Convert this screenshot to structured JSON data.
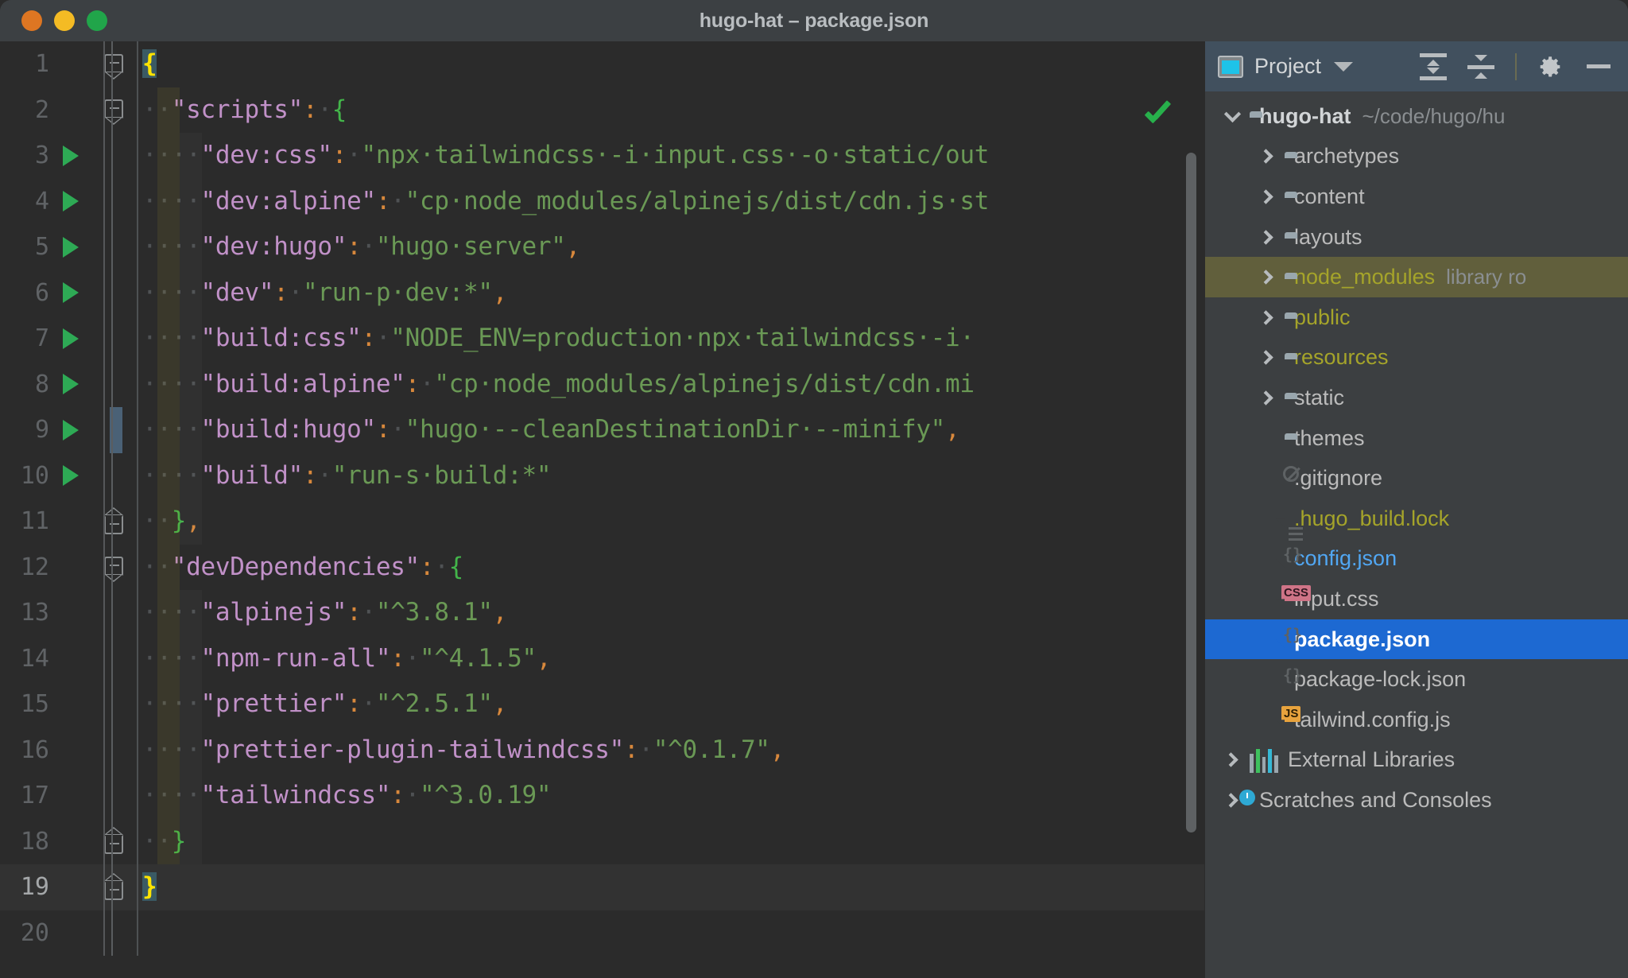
{
  "window": {
    "title": "hugo-hat – package.json",
    "traffic_lights": [
      "close-red",
      "minimize-yellow",
      "zoom-green"
    ]
  },
  "editor": {
    "file": "package.json",
    "inspection_status": "ok",
    "current_line": 19,
    "lines": [
      {
        "n": 1,
        "run": false,
        "fold": "top",
        "tokens": [
          {
            "t": "brace-hl",
            "v": "{"
          }
        ]
      },
      {
        "n": 2,
        "run": false,
        "fold": "top",
        "tokens": [
          {
            "t": "dot",
            "v": "··"
          },
          {
            "t": "key",
            "v": "\"scripts\""
          },
          {
            "t": "punct",
            "v": ":"
          },
          {
            "t": "dot",
            "v": "·"
          },
          {
            "t": "brace",
            "v": "{"
          }
        ]
      },
      {
        "n": 3,
        "run": true,
        "fold": "",
        "tokens": [
          {
            "t": "dot",
            "v": "····"
          },
          {
            "t": "key",
            "v": "\"dev:css\""
          },
          {
            "t": "punct",
            "v": ":"
          },
          {
            "t": "dot",
            "v": "·"
          },
          {
            "t": "str",
            "v": "\"npx·tailwindcss·-i·input.css·-o·static/out"
          }
        ]
      },
      {
        "n": 4,
        "run": true,
        "fold": "",
        "tokens": [
          {
            "t": "dot",
            "v": "····"
          },
          {
            "t": "key",
            "v": "\"dev:alpine\""
          },
          {
            "t": "punct",
            "v": ":"
          },
          {
            "t": "dot",
            "v": "·"
          },
          {
            "t": "str",
            "v": "\"cp·node_modules/alpinejs/dist/cdn.js·st"
          }
        ]
      },
      {
        "n": 5,
        "run": true,
        "fold": "",
        "tokens": [
          {
            "t": "dot",
            "v": "····"
          },
          {
            "t": "key",
            "v": "\"dev:hugo\""
          },
          {
            "t": "punct",
            "v": ":"
          },
          {
            "t": "dot",
            "v": "·"
          },
          {
            "t": "str",
            "v": "\"hugo·server\""
          },
          {
            "t": "punct",
            "v": ","
          }
        ]
      },
      {
        "n": 6,
        "run": true,
        "fold": "",
        "tokens": [
          {
            "t": "dot",
            "v": "····"
          },
          {
            "t": "key",
            "v": "\"dev\""
          },
          {
            "t": "punct",
            "v": ":"
          },
          {
            "t": "dot",
            "v": "·"
          },
          {
            "t": "str",
            "v": "\"run-p·dev:*\""
          },
          {
            "t": "punct",
            "v": ","
          }
        ]
      },
      {
        "n": 7,
        "run": true,
        "fold": "",
        "tokens": [
          {
            "t": "dot",
            "v": "····"
          },
          {
            "t": "key",
            "v": "\"build:css\""
          },
          {
            "t": "punct",
            "v": ":"
          },
          {
            "t": "dot",
            "v": "·"
          },
          {
            "t": "str",
            "v": "\"NODE_ENV=production·npx·tailwindcss·-i·"
          }
        ]
      },
      {
        "n": 8,
        "run": true,
        "fold": "",
        "tokens": [
          {
            "t": "dot",
            "v": "····"
          },
          {
            "t": "key",
            "v": "\"build:alpine\""
          },
          {
            "t": "punct",
            "v": ":"
          },
          {
            "t": "dot",
            "v": "·"
          },
          {
            "t": "str",
            "v": "\"cp·node_modules/alpinejs/dist/cdn.mi"
          }
        ]
      },
      {
        "n": 9,
        "run": true,
        "fold": "",
        "changed": true,
        "tokens": [
          {
            "t": "dot",
            "v": "····"
          },
          {
            "t": "key",
            "v": "\"build:hugo\""
          },
          {
            "t": "punct",
            "v": ":"
          },
          {
            "t": "dot",
            "v": "·"
          },
          {
            "t": "str",
            "v": "\"hugo·--cleanDestinationDir·--minify\""
          },
          {
            "t": "punct",
            "v": ","
          }
        ]
      },
      {
        "n": 10,
        "run": true,
        "fold": "",
        "tokens": [
          {
            "t": "dot",
            "v": "····"
          },
          {
            "t": "key",
            "v": "\"build\""
          },
          {
            "t": "punct",
            "v": ":"
          },
          {
            "t": "dot",
            "v": "·"
          },
          {
            "t": "str",
            "v": "\"run-s·build:*\""
          }
        ]
      },
      {
        "n": 11,
        "run": false,
        "fold": "bot",
        "tokens": [
          {
            "t": "dot",
            "v": "··"
          },
          {
            "t": "brace",
            "v": "}"
          },
          {
            "t": "punct",
            "v": ","
          }
        ]
      },
      {
        "n": 12,
        "run": false,
        "fold": "top",
        "tokens": [
          {
            "t": "dot",
            "v": "··"
          },
          {
            "t": "key",
            "v": "\"devDependencies\""
          },
          {
            "t": "punct",
            "v": ":"
          },
          {
            "t": "dot",
            "v": "·"
          },
          {
            "t": "brace",
            "v": "{"
          }
        ]
      },
      {
        "n": 13,
        "run": false,
        "fold": "",
        "tokens": [
          {
            "t": "dot",
            "v": "····"
          },
          {
            "t": "key",
            "v": "\"alpinejs\""
          },
          {
            "t": "punct",
            "v": ":"
          },
          {
            "t": "dot",
            "v": "·"
          },
          {
            "t": "str",
            "v": "\"^3.8.1\""
          },
          {
            "t": "punct",
            "v": ","
          }
        ]
      },
      {
        "n": 14,
        "run": false,
        "fold": "",
        "tokens": [
          {
            "t": "dot",
            "v": "····"
          },
          {
            "t": "key",
            "v": "\"npm-run-all\""
          },
          {
            "t": "punct",
            "v": ":"
          },
          {
            "t": "dot",
            "v": "·"
          },
          {
            "t": "str",
            "v": "\"^4.1.5\""
          },
          {
            "t": "punct",
            "v": ","
          }
        ]
      },
      {
        "n": 15,
        "run": false,
        "fold": "",
        "tokens": [
          {
            "t": "dot",
            "v": "····"
          },
          {
            "t": "key",
            "v": "\"prettier\""
          },
          {
            "t": "punct",
            "v": ":"
          },
          {
            "t": "dot",
            "v": "·"
          },
          {
            "t": "str",
            "v": "\"^2.5.1\""
          },
          {
            "t": "punct",
            "v": ","
          }
        ]
      },
      {
        "n": 16,
        "run": false,
        "fold": "",
        "tokens": [
          {
            "t": "dot",
            "v": "····"
          },
          {
            "t": "key",
            "v": "\"prettier-plugin-tailwindcss\""
          },
          {
            "t": "punct",
            "v": ":"
          },
          {
            "t": "dot",
            "v": "·"
          },
          {
            "t": "str",
            "v": "\"^0.1.7\""
          },
          {
            "t": "punct",
            "v": ","
          }
        ]
      },
      {
        "n": 17,
        "run": false,
        "fold": "",
        "tokens": [
          {
            "t": "dot",
            "v": "····"
          },
          {
            "t": "key",
            "v": "\"tailwindcss\""
          },
          {
            "t": "punct",
            "v": ":"
          },
          {
            "t": "dot",
            "v": "·"
          },
          {
            "t": "str",
            "v": "\"^3.0.19\""
          }
        ]
      },
      {
        "n": 18,
        "run": false,
        "fold": "bot",
        "tokens": [
          {
            "t": "dot",
            "v": "··"
          },
          {
            "t": "brace",
            "v": "}"
          }
        ]
      },
      {
        "n": 19,
        "run": false,
        "fold": "bot",
        "current": true,
        "tokens": [
          {
            "t": "brace-hl",
            "v": "}"
          }
        ]
      },
      {
        "n": 20,
        "run": false,
        "fold": "",
        "tokens": []
      }
    ]
  },
  "project_panel": {
    "title": "Project",
    "toolbar": [
      "project-view-dropdown",
      "expand-all-icon",
      "collapse-all-icon",
      "settings-gear-icon",
      "minimize-icon"
    ],
    "tree": [
      {
        "label": "hugo-hat",
        "hint": "~/code/hugo/hu",
        "indent": 0,
        "arrow": "down",
        "icon": "folder",
        "style": "bold"
      },
      {
        "label": "archetypes",
        "hint": "",
        "indent": 1,
        "arrow": "right",
        "icon": "folder",
        "style": "normal"
      },
      {
        "label": "content",
        "hint": "",
        "indent": 1,
        "arrow": "right",
        "icon": "folder",
        "style": "normal"
      },
      {
        "label": "layouts",
        "hint": "",
        "indent": 1,
        "arrow": "right",
        "icon": "folder",
        "style": "normal"
      },
      {
        "label": "node_modules",
        "hint": "library ro",
        "indent": 1,
        "arrow": "right",
        "icon": "folder",
        "style": "olive",
        "row": "highlight"
      },
      {
        "label": "public",
        "hint": "",
        "indent": 1,
        "arrow": "right",
        "icon": "folder",
        "style": "olive"
      },
      {
        "label": "resources",
        "hint": "",
        "indent": 1,
        "arrow": "right",
        "icon": "folder",
        "style": "olive"
      },
      {
        "label": "static",
        "hint": "",
        "indent": 1,
        "arrow": "right",
        "icon": "folder",
        "style": "normal"
      },
      {
        "label": "themes",
        "hint": "",
        "indent": 1,
        "arrow": "none",
        "icon": "folder",
        "style": "normal"
      },
      {
        "label": ".gitignore",
        "hint": "",
        "indent": 1,
        "arrow": "none",
        "icon": "file-ignored",
        "style": "normal"
      },
      {
        "label": ".hugo_build.lock",
        "hint": "",
        "indent": 1,
        "arrow": "none",
        "icon": "file-text",
        "style": "olive"
      },
      {
        "label": "config.json",
        "hint": "",
        "indent": 1,
        "arrow": "none",
        "icon": "file-json",
        "style": "blue"
      },
      {
        "label": "input.css",
        "hint": "",
        "indent": 1,
        "arrow": "none",
        "icon": "file-css",
        "style": "normal"
      },
      {
        "label": "package.json",
        "hint": "",
        "indent": 1,
        "arrow": "none",
        "icon": "file-json",
        "style": "selected",
        "row": "selected"
      },
      {
        "label": "package-lock.json",
        "hint": "",
        "indent": 1,
        "arrow": "none",
        "icon": "file-json",
        "style": "normal"
      },
      {
        "label": "tailwind.config.js",
        "hint": "",
        "indent": 1,
        "arrow": "none",
        "icon": "file-js",
        "style": "normal"
      },
      {
        "label": "External Libraries",
        "hint": "",
        "indent": 0,
        "arrow": "right",
        "icon": "libraries",
        "style": "normal"
      },
      {
        "label": "Scratches and Consoles",
        "hint": "",
        "indent": 0,
        "arrow": "right",
        "icon": "scratches",
        "style": "normal"
      }
    ]
  },
  "colors": {
    "titlebar_bg": "#3c4043",
    "editor_bg": "#2b2b2b",
    "panel_bg": "#3c3f41",
    "selection_blue": "#1d69d2",
    "panel_header_blue": "#41505e",
    "string_green": "#6a9955",
    "key_purple": "#c191c8",
    "punct_orange": "#d8883c",
    "brace_green": "#43b54a",
    "run_arrow_green": "#2eaa55",
    "olive_text": "#a5a42a",
    "blue_text": "#51a7f3",
    "highlight_row": "#615f3c"
  }
}
